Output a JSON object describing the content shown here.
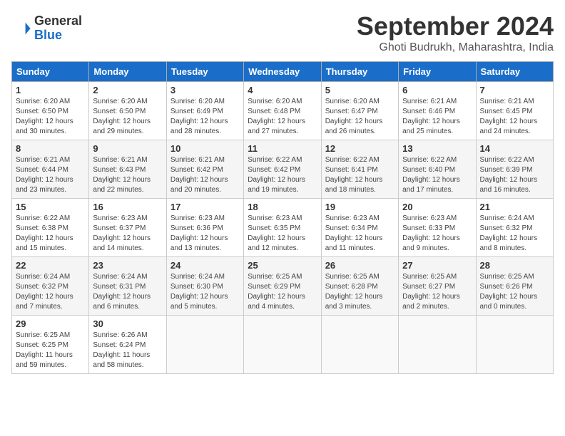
{
  "header": {
    "logo_general": "General",
    "logo_blue": "Blue",
    "month_title": "September 2024",
    "subtitle": "Ghoti Budrukh, Maharashtra, India"
  },
  "days_of_week": [
    "Sunday",
    "Monday",
    "Tuesday",
    "Wednesday",
    "Thursday",
    "Friday",
    "Saturday"
  ],
  "weeks": [
    [
      {
        "day": "1",
        "sunrise": "6:20 AM",
        "sunset": "6:50 PM",
        "daylight": "12 hours and 30 minutes."
      },
      {
        "day": "2",
        "sunrise": "6:20 AM",
        "sunset": "6:50 PM",
        "daylight": "12 hours and 29 minutes."
      },
      {
        "day": "3",
        "sunrise": "6:20 AM",
        "sunset": "6:49 PM",
        "daylight": "12 hours and 28 minutes."
      },
      {
        "day": "4",
        "sunrise": "6:20 AM",
        "sunset": "6:48 PM",
        "daylight": "12 hours and 27 minutes."
      },
      {
        "day": "5",
        "sunrise": "6:20 AM",
        "sunset": "6:47 PM",
        "daylight": "12 hours and 26 minutes."
      },
      {
        "day": "6",
        "sunrise": "6:21 AM",
        "sunset": "6:46 PM",
        "daylight": "12 hours and 25 minutes."
      },
      {
        "day": "7",
        "sunrise": "6:21 AM",
        "sunset": "6:45 PM",
        "daylight": "12 hours and 24 minutes."
      }
    ],
    [
      {
        "day": "8",
        "sunrise": "6:21 AM",
        "sunset": "6:44 PM",
        "daylight": "12 hours and 23 minutes."
      },
      {
        "day": "9",
        "sunrise": "6:21 AM",
        "sunset": "6:43 PM",
        "daylight": "12 hours and 22 minutes."
      },
      {
        "day": "10",
        "sunrise": "6:21 AM",
        "sunset": "6:42 PM",
        "daylight": "12 hours and 20 minutes."
      },
      {
        "day": "11",
        "sunrise": "6:22 AM",
        "sunset": "6:42 PM",
        "daylight": "12 hours and 19 minutes."
      },
      {
        "day": "12",
        "sunrise": "6:22 AM",
        "sunset": "6:41 PM",
        "daylight": "12 hours and 18 minutes."
      },
      {
        "day": "13",
        "sunrise": "6:22 AM",
        "sunset": "6:40 PM",
        "daylight": "12 hours and 17 minutes."
      },
      {
        "day": "14",
        "sunrise": "6:22 AM",
        "sunset": "6:39 PM",
        "daylight": "12 hours and 16 minutes."
      }
    ],
    [
      {
        "day": "15",
        "sunrise": "6:22 AM",
        "sunset": "6:38 PM",
        "daylight": "12 hours and 15 minutes."
      },
      {
        "day": "16",
        "sunrise": "6:23 AM",
        "sunset": "6:37 PM",
        "daylight": "12 hours and 14 minutes."
      },
      {
        "day": "17",
        "sunrise": "6:23 AM",
        "sunset": "6:36 PM",
        "daylight": "12 hours and 13 minutes."
      },
      {
        "day": "18",
        "sunrise": "6:23 AM",
        "sunset": "6:35 PM",
        "daylight": "12 hours and 12 minutes."
      },
      {
        "day": "19",
        "sunrise": "6:23 AM",
        "sunset": "6:34 PM",
        "daylight": "12 hours and 11 minutes."
      },
      {
        "day": "20",
        "sunrise": "6:23 AM",
        "sunset": "6:33 PM",
        "daylight": "12 hours and 9 minutes."
      },
      {
        "day": "21",
        "sunrise": "6:24 AM",
        "sunset": "6:32 PM",
        "daylight": "12 hours and 8 minutes."
      }
    ],
    [
      {
        "day": "22",
        "sunrise": "6:24 AM",
        "sunset": "6:32 PM",
        "daylight": "12 hours and 7 minutes."
      },
      {
        "day": "23",
        "sunrise": "6:24 AM",
        "sunset": "6:31 PM",
        "daylight": "12 hours and 6 minutes."
      },
      {
        "day": "24",
        "sunrise": "6:24 AM",
        "sunset": "6:30 PM",
        "daylight": "12 hours and 5 minutes."
      },
      {
        "day": "25",
        "sunrise": "6:25 AM",
        "sunset": "6:29 PM",
        "daylight": "12 hours and 4 minutes."
      },
      {
        "day": "26",
        "sunrise": "6:25 AM",
        "sunset": "6:28 PM",
        "daylight": "12 hours and 3 minutes."
      },
      {
        "day": "27",
        "sunrise": "6:25 AM",
        "sunset": "6:27 PM",
        "daylight": "12 hours and 2 minutes."
      },
      {
        "day": "28",
        "sunrise": "6:25 AM",
        "sunset": "6:26 PM",
        "daylight": "12 hours and 0 minutes."
      }
    ],
    [
      {
        "day": "29",
        "sunrise": "6:25 AM",
        "sunset": "6:25 PM",
        "daylight": "11 hours and 59 minutes."
      },
      {
        "day": "30",
        "sunrise": "6:26 AM",
        "sunset": "6:24 PM",
        "daylight": "11 hours and 58 minutes."
      },
      null,
      null,
      null,
      null,
      null
    ]
  ]
}
